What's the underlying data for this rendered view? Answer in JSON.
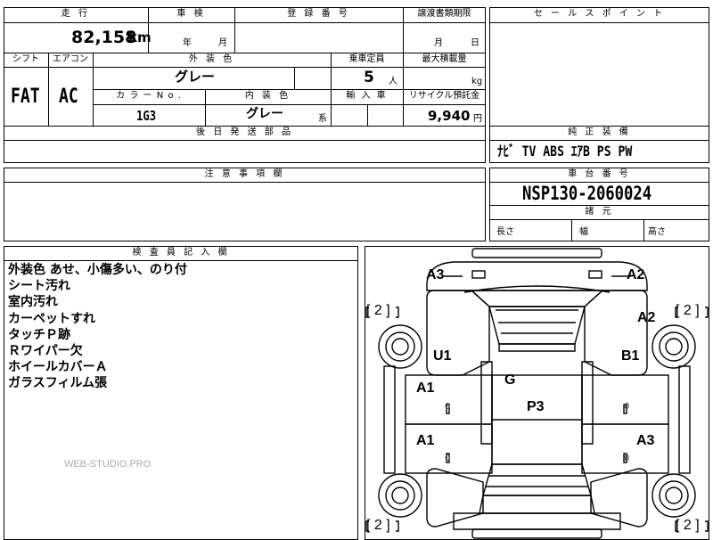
{
  "sheet": {
    "mileage": {
      "header": "走 行",
      "value": "82,158",
      "unit": "km"
    },
    "inspection": {
      "header": "車 検",
      "year_unit": "年",
      "month_unit": "月"
    },
    "registration": {
      "header": "登 録 番 号"
    },
    "transfer_deadline": {
      "header": "譲渡書類期限",
      "month_unit": "月",
      "day_unit": "日"
    },
    "shift": {
      "header": "シフト",
      "value": "FAT"
    },
    "aircon": {
      "header": "エアコン",
      "value": "AC"
    },
    "exterior_color": {
      "header": "外 装 色",
      "value": "グレー"
    },
    "capacity": {
      "header": "乗車定員",
      "value": "5",
      "unit": "人"
    },
    "max_load": {
      "header": "最大積載量",
      "unit": "kg"
    },
    "color_no": {
      "header": "カ ラ ー N o .",
      "value": "1G3"
    },
    "interior_color": {
      "header": "内 装 色",
      "value": "グレー",
      "suffix": "系"
    },
    "import": {
      "header": "輸 入 車"
    },
    "recycle": {
      "header": "リサイクル預託金",
      "value": "9,940",
      "unit": "円"
    },
    "later_parts": {
      "header": "後 日 発 送 部 品"
    },
    "caution": {
      "header": "注 意 事 項 欄"
    },
    "sales_point": {
      "header": "セ ー ル ス ポ イ ン ト"
    },
    "equipment": {
      "header": "純 正 装 備",
      "value": "ﾅﾋﾞ  TV  ABS  ｴｱB  PS  PW"
    },
    "chassis": {
      "header": "車 台 番 号",
      "value": "NSP130-2060024"
    },
    "dimensions": {
      "header": "諸 元",
      "length": "長さ",
      "width": "幅",
      "height": "高さ"
    },
    "inspector": {
      "header": "検 査 員 記 入 欄",
      "notes": [
        "外装色 あせ、小傷多い、のり付",
        "シート汚れ",
        "室内汚れ",
        "カーペットすれ",
        "タッチＰ跡",
        "Ｒワイパー欠",
        "ホイールカバーＡ",
        "ガラスフィルム張"
      ]
    },
    "diagram": {
      "marks": {
        "a3_tl": "A3",
        "a2_tr": "A2",
        "a2_r": "A2",
        "u1": "U1",
        "b1": "B1",
        "g": "G",
        "p3": "P3",
        "a1_l1": "A1",
        "a1_l2": "A1",
        "a3_r": "A3"
      },
      "tread_depths": {
        "fl": "[ 2 ]",
        "fr": "[ 2 ]",
        "rl": "[ 2 ]",
        "rr": "[ 2 ]"
      },
      "zeros": [
        "0",
        "0",
        "0",
        "0"
      ]
    },
    "watermark": "WEB-STUDIO.PRO"
  }
}
